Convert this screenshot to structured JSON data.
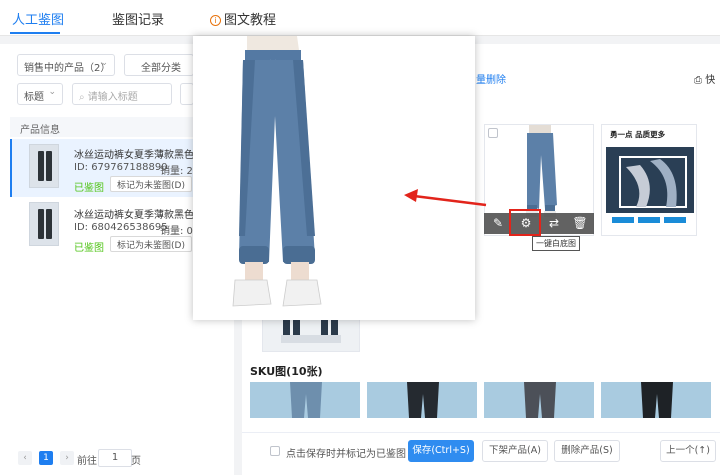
{
  "tabs": [
    {
      "label": "人工鉴图",
      "active": true
    },
    {
      "label": "鉴图记录",
      "active": false
    },
    {
      "label": "图文教程",
      "active": false
    }
  ],
  "filters": {
    "status_select": "销售中的产品（2）",
    "category_select": "全部分类",
    "field_select": "标题",
    "search_placeholder": "请输入标题"
  },
  "product_list": {
    "header": "产品信息",
    "items": [
      {
        "title": "冰丝运动裤女夏季薄款黑色裤子束",
        "id_text": "ID:  679767188890",
        "sales_text": "销量:  2",
        "status": "已鉴图",
        "mark_label": "标记为未鉴图(D)",
        "active": true
      },
      {
        "title": "冰丝运动裤女夏季薄款黑色裤子束",
        "id_text": "ID:  680426538695",
        "sales_text": "销量:  0",
        "status": "已鉴图",
        "mark_label": "标记为未鉴图(D)",
        "active": false
      }
    ]
  },
  "pagination": {
    "current_page": "1",
    "goto_label": "前往",
    "goto_value": "1",
    "page_suffix": "页"
  },
  "right_panel": {
    "batch_delete_link": "量删除",
    "quick_link": "快",
    "tooltip": "一键白底图",
    "poster_title": "勇一点 品质更多",
    "sku_title": "SKU图(10张)"
  },
  "bottom_bar": {
    "save_checkbox_label": "点击保存时并标记为已鉴图",
    "save_button": "保存(Ctrl+S)",
    "remove_button": "下架产品(A)",
    "delete_button": "删除产品(S)",
    "prev_button": "上一个(↑)"
  },
  "colors": {
    "accent": "#1e7ef0",
    "success": "#52c41a",
    "highlight": "#e2241b",
    "pants": "#5c80a8"
  }
}
